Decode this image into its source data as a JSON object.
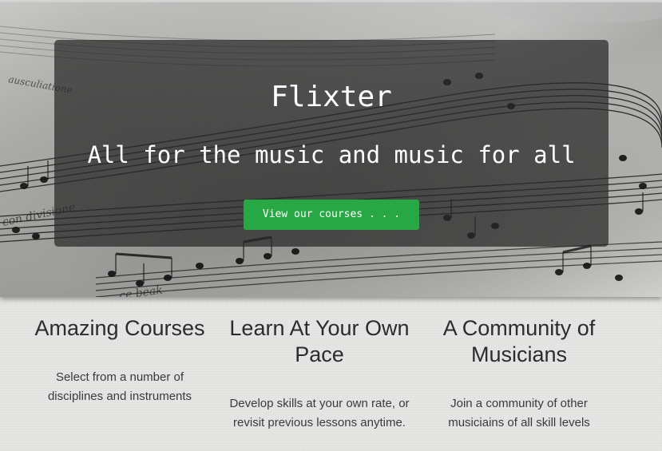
{
  "hero": {
    "title": "Flixter",
    "tagline": "All for the music and music for all",
    "cta_label": "View our courses . . ."
  },
  "features": [
    {
      "heading": "Amazing Courses",
      "text": "Select from a number of disciplines and instruments"
    },
    {
      "heading": "Learn At Your Own Pace",
      "text": "Develop skills at your own rate, or revisit previous lessons anytime."
    },
    {
      "heading": "A Community of Musicians",
      "text": "Join a community of other musiciains of all skill levels"
    }
  ],
  "colors": {
    "cta": "#28a745",
    "overlay": "#282828",
    "page_bg": "#e6e6e4"
  }
}
